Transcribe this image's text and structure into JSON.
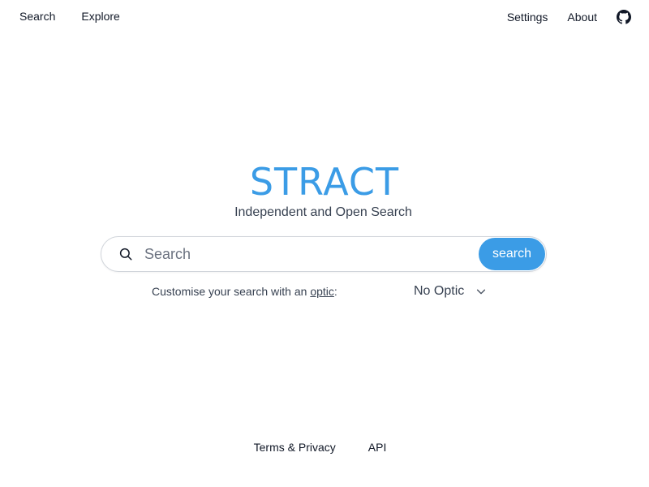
{
  "nav": {
    "left": [
      {
        "label": "Search"
      },
      {
        "label": "Explore"
      }
    ],
    "right": [
      {
        "label": "Settings"
      },
      {
        "label": "About"
      }
    ],
    "github_icon": "github-icon"
  },
  "hero": {
    "logo": "STRACT",
    "tagline": "Independent and Open Search"
  },
  "search": {
    "placeholder": "Search",
    "value": "",
    "button_label": "search",
    "icon": "search-icon"
  },
  "optic": {
    "prefix": "Customise your search with an ",
    "link_text": "optic",
    "suffix": ":",
    "selected": "No Optic",
    "icon": "chevron-down-icon"
  },
  "footer": {
    "links": [
      {
        "label": "Terms & Privacy"
      },
      {
        "label": "API"
      }
    ]
  },
  "colors": {
    "accent": "#3b9ce6",
    "text": "#111827"
  }
}
